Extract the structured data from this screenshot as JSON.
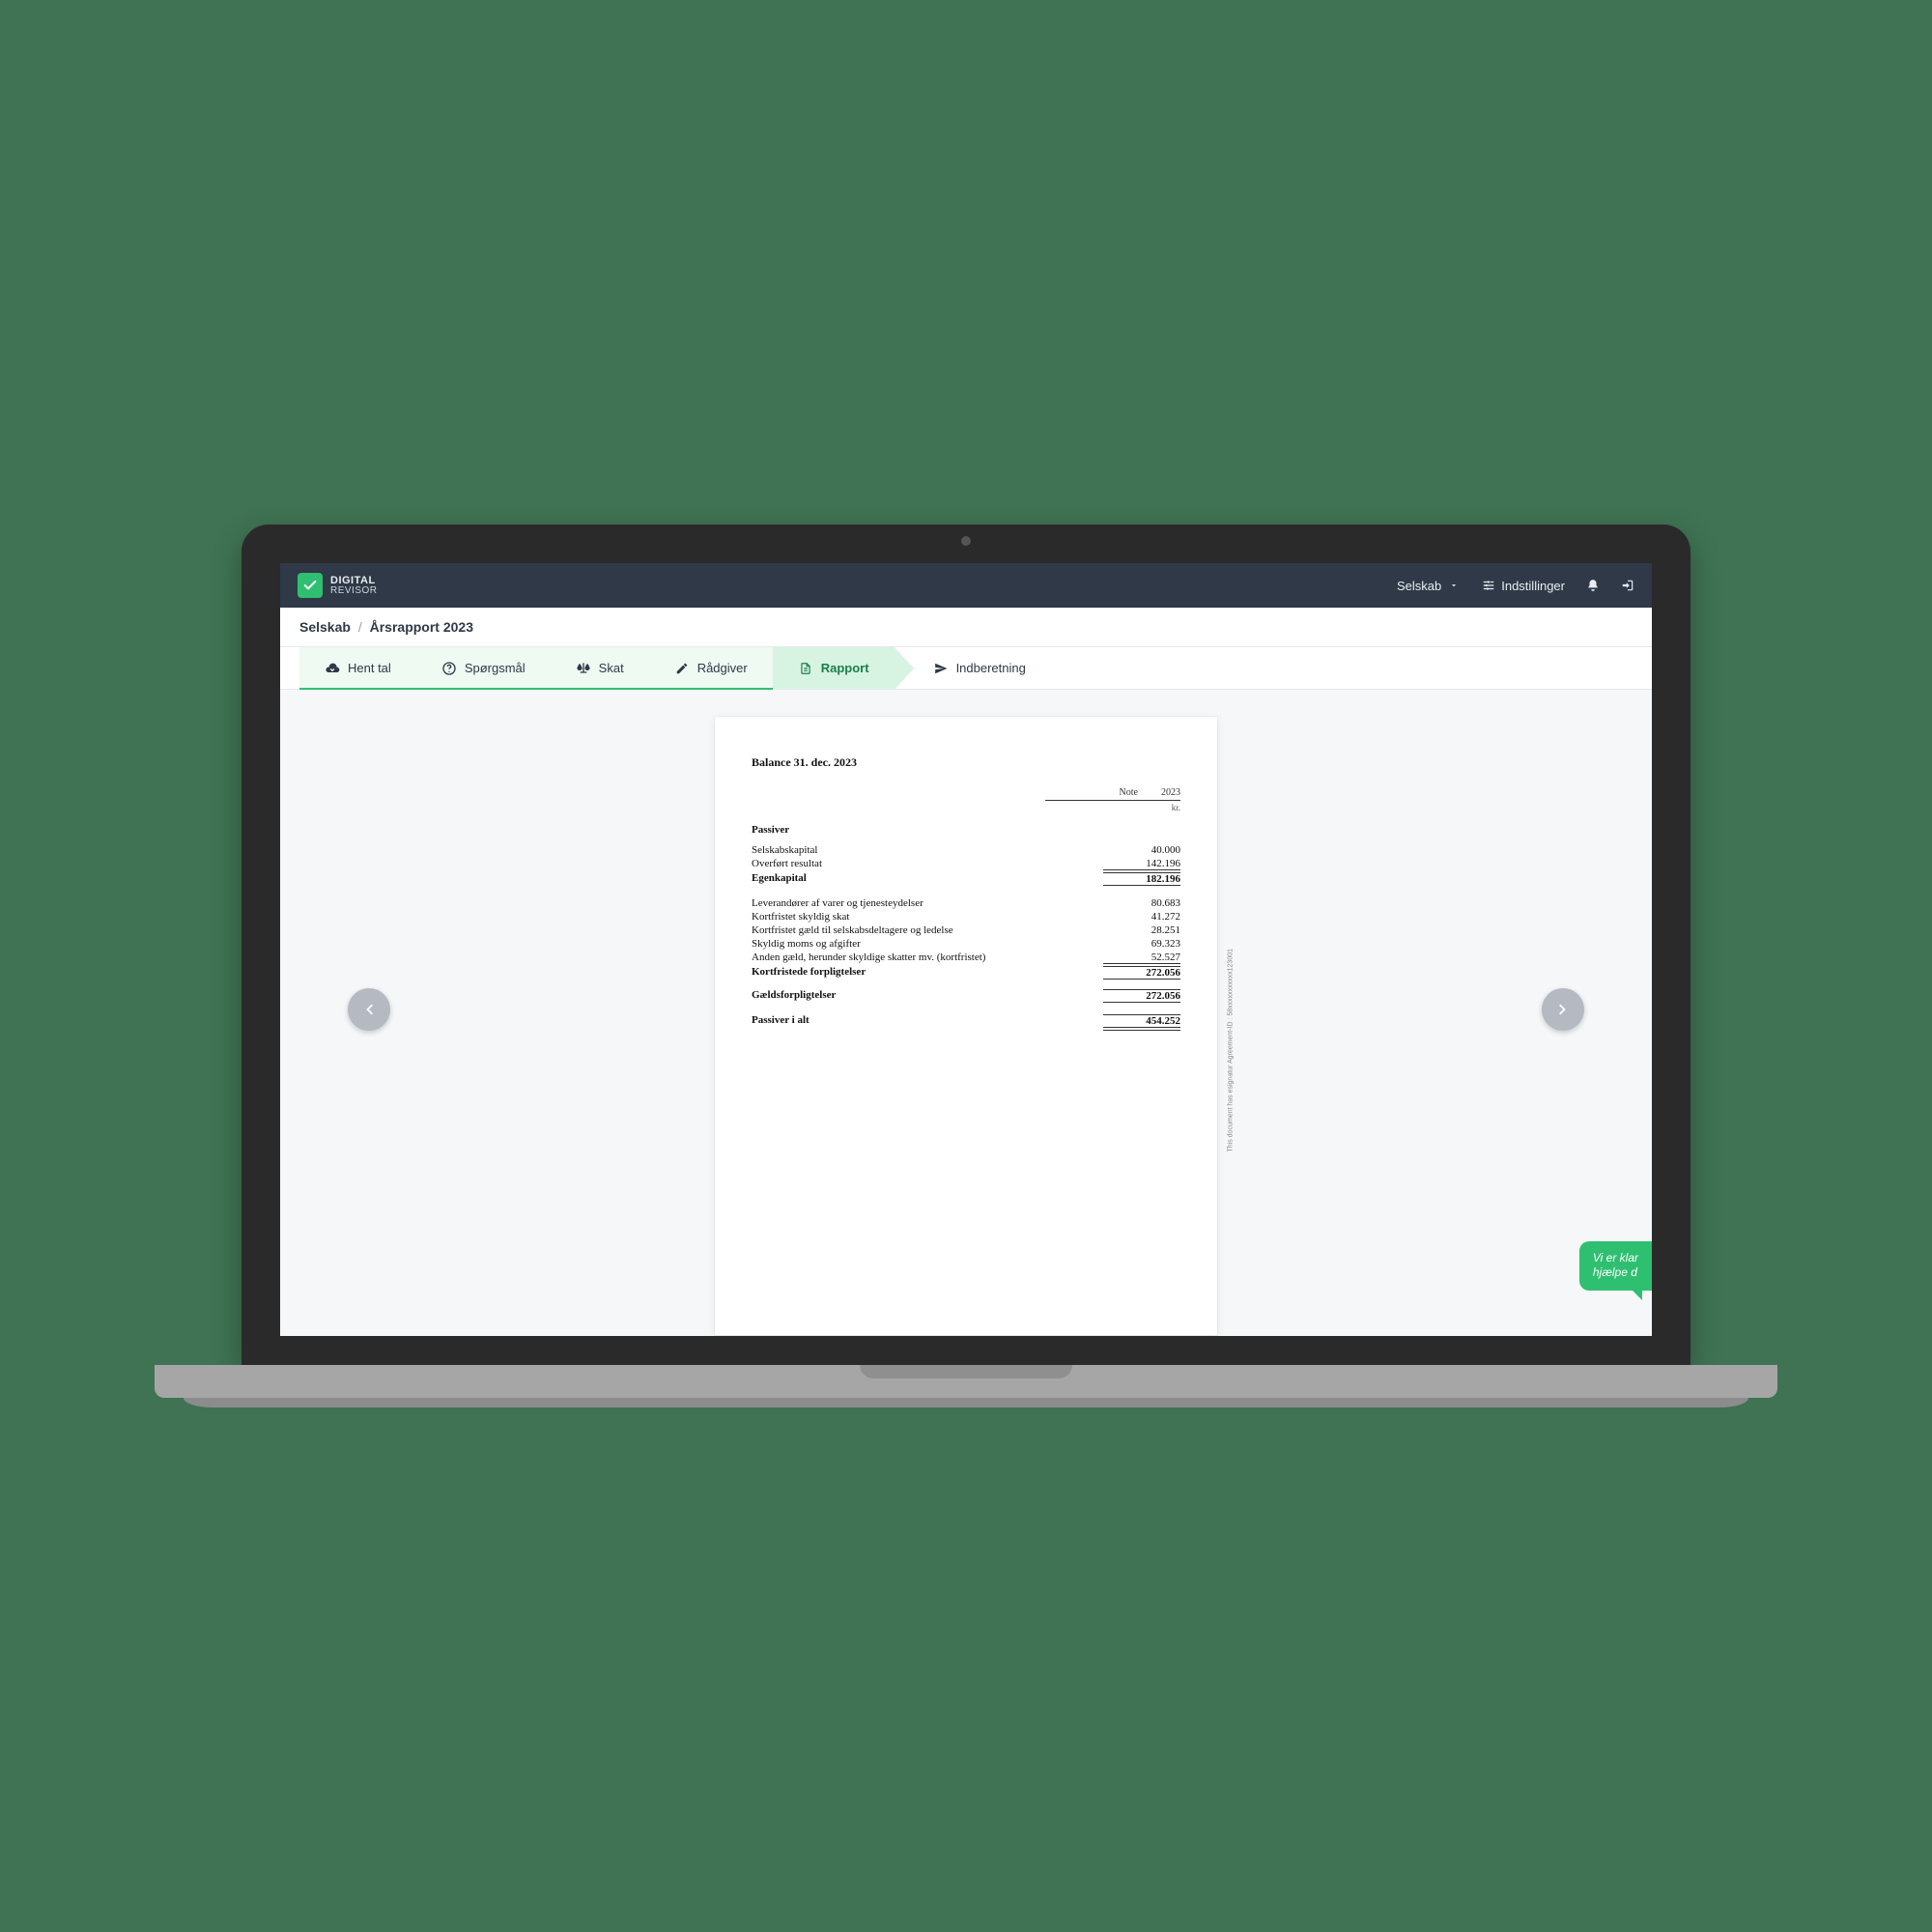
{
  "brand": {
    "line1": "DIGITAL",
    "line2": "REVISOR"
  },
  "topnav": {
    "company_label": "Selskab",
    "settings_label": "Indstillinger"
  },
  "breadcrumb": {
    "root": "Selskab",
    "page": "Årsrapport 2023"
  },
  "steps": [
    {
      "label": "Hent tal"
    },
    {
      "label": "Spørgsmål"
    },
    {
      "label": "Skat"
    },
    {
      "label": "Rådgiver"
    },
    {
      "label": "Rapport"
    },
    {
      "label": "Indberetning"
    }
  ],
  "document": {
    "title": "Balance 31. dec. 2023",
    "col_note": "Note",
    "col_year": "2023",
    "unit": "kr.",
    "section_passiver": "Passiver",
    "rows_equity": [
      {
        "label": "Selskabskapital",
        "value": "40.000"
      },
      {
        "label": "Overført resultat",
        "value": "142.196"
      }
    ],
    "equity_total": {
      "label": "Egenkapital",
      "value": "182.196"
    },
    "rows_liab": [
      {
        "label": "Leverandører af varer og tjenesteydelser",
        "value": "80.683"
      },
      {
        "label": "Kortfristet skyldig skat",
        "value": "41.272"
      },
      {
        "label": "Kortfristet gæld til selskabsdeltagere og ledelse",
        "value": "28.251"
      },
      {
        "label": "Skyldig moms og afgifter",
        "value": "69.323"
      },
      {
        "label": "Anden gæld, herunder skyldige skatter mv. (kortfristet)",
        "value": "52.527"
      }
    ],
    "liab_short_total": {
      "label": "Kortfristede forpligtelser",
      "value": "272.056"
    },
    "liab_total": {
      "label": "Gældsforpligtelser",
      "value": "272.056"
    },
    "grand_total": {
      "label": "Passiver i alt",
      "value": "454.252"
    },
    "side_note": "This document has esignatur Agreement-ID : 58xxxxxxxxxxx123001"
  },
  "help": {
    "line1": "Vi er klar",
    "line2": "hjælpe d"
  }
}
